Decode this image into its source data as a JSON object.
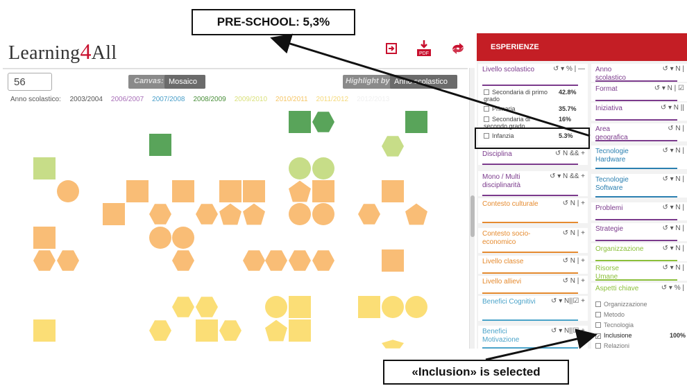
{
  "brand": {
    "prefix": "Learning",
    "number": "4",
    "suffix": "All"
  },
  "toolbar": {
    "icons": [
      "login-icon",
      "pdf-icon",
      "share-icon"
    ],
    "pdf_label": "PDF"
  },
  "callouts": {
    "preschool": "PRE-SCHOOL: 5,3%",
    "inclusion": "«Inclusion» is selected"
  },
  "canvas": {
    "count": "56",
    "canvas_label": "Canvas:",
    "canvas_value": "Mosaico ▾",
    "highlight_label": "Highlight by:",
    "highlight_value": "Anno scolastico ▾",
    "years_label": "Anno scolastico:",
    "years": [
      {
        "label": "2003/2004",
        "color": "#555555"
      },
      {
        "label": "2006/2007",
        "color": "#a86fb8"
      },
      {
        "label": "2007/2008",
        "color": "#4a9fc9"
      },
      {
        "label": "2008/2009",
        "color": "#4a8f3a"
      },
      {
        "label": "2009/2010",
        "color": "#d9e07a"
      },
      {
        "label": "2010/2011",
        "color": "#f5c565"
      },
      {
        "label": "2011/2012",
        "color": "#f5d97a"
      },
      {
        "label": "2012/2013",
        "color": "#f0f0f0"
      }
    ]
  },
  "panel": {
    "header": "ESPERIENZE",
    "left": [
      {
        "title": "Livello scolastico",
        "ctrls": "↺ ▾ % | —",
        "color": "#7b3a8c"
      },
      {
        "title": "Disciplina",
        "ctrls": "↺ N && +",
        "color": "#7b3a8c"
      },
      {
        "title": "Mono / Multi disciplinarità",
        "ctrls": "↺ ▾ N && +",
        "color": "#7b3a8c"
      },
      {
        "title": "Contesto culturale",
        "ctrls": "↺ N | +",
        "color": "#e58a2e"
      },
      {
        "title": "Contesto socio-economico",
        "ctrls": "↺ N | +",
        "color": "#e58a2e"
      },
      {
        "title": "Livello classe",
        "ctrls": "↺ N | +",
        "color": "#e58a2e"
      },
      {
        "title": "Livello allievi",
        "ctrls": "↺ N | +",
        "color": "#e58a2e"
      },
      {
        "title": "Benefici Cognitivi",
        "ctrls": "↺ ▾ N||☑ +",
        "color": "#4aa3c9"
      },
      {
        "title": "Benefici Motivazione",
        "ctrls": "↺ ▾ N||☑ +",
        "color": "#4aa3c9"
      }
    ],
    "livello_options": [
      {
        "label": "Secondaria di primo grado",
        "pct": "42.8%"
      },
      {
        "label": "Primaria",
        "pct": "35.7%"
      },
      {
        "label": "Secondaria di secondo grado",
        "pct": "16%"
      },
      {
        "label": "Infanzia",
        "pct": "5.3%"
      }
    ],
    "right": [
      {
        "title": "Anno scolastico",
        "ctrls": "↺ ▾ N |",
        "color": "#7b3a8c"
      },
      {
        "title": "Format",
        "ctrls": "↺ ▾ N | ☑",
        "color": "#7b3a8c"
      },
      {
        "title": "Iniziativa",
        "ctrls": "↺ ▾ N ||",
        "color": "#7b3a8c"
      },
      {
        "title": "Area geografica",
        "ctrls": "↺ N |",
        "color": "#7b3a8c"
      },
      {
        "title": "Tecnologie Hardware",
        "ctrls": "↺ ▾ N |",
        "color": "#2a7fb0"
      },
      {
        "title": "Tecnologie Software",
        "ctrls": "↺ ▾ N |",
        "color": "#2a7fb0"
      },
      {
        "title": "Problemi",
        "ctrls": "↺ ▾ N |",
        "color": "#7b3a8c"
      },
      {
        "title": "Strategie",
        "ctrls": "↺ ▾ N |",
        "color": "#7b3a8c"
      },
      {
        "title": "Organizzazione",
        "ctrls": "↺ ▾ N |",
        "color": "#8bbf3a"
      },
      {
        "title": "Risorse Umane",
        "ctrls": "↺ ▾ N |",
        "color": "#8bbf3a"
      },
      {
        "title": "Aspetti chiave",
        "ctrls": "↺ ▾ % |",
        "color": "#8bbf3a"
      }
    ],
    "aspetti_options": [
      {
        "label": "Organizzazione",
        "checked": false
      },
      {
        "label": "Metodo",
        "checked": false
      },
      {
        "label": "Tecnologia",
        "checked": false
      },
      {
        "label": "Inclusione",
        "checked": true,
        "pct": "100%"
      },
      {
        "label": "Relazioni",
        "checked": false
      }
    ]
  }
}
